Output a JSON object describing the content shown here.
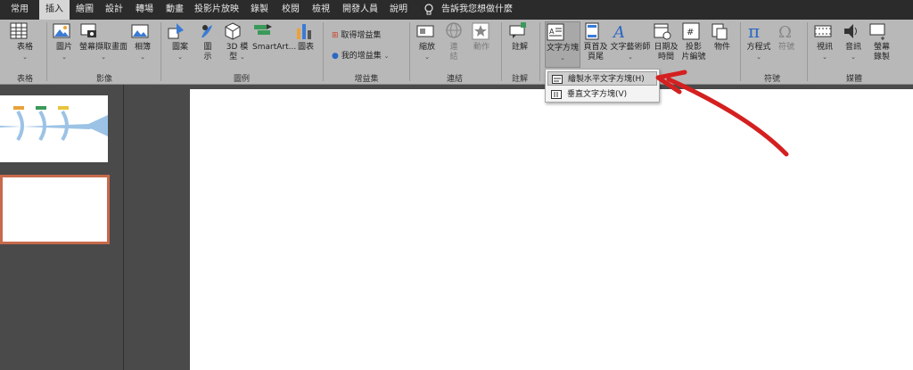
{
  "tabs": [
    "常用",
    "插入",
    "繪圖",
    "設計",
    "轉場",
    "動畫",
    "投影片放映",
    "錄製",
    "校閱",
    "檢視",
    "開發人員",
    "說明"
  ],
  "active_tab": "插入",
  "tell_me": "告訴我您想做什麼",
  "ribbon": {
    "table": {
      "label": "表格"
    },
    "images": {
      "pictures": "圖片",
      "screenshot": "螢幕擷取畫面",
      "album": "相簿"
    },
    "illustrations": {
      "shapes": "圖案",
      "icons_line1": "圖",
      "icons_line2": "示",
      "models_line1": "3D 模",
      "models_line2": "型",
      "smartart": "SmartArt...",
      "chart": "圖表"
    },
    "addins": {
      "get": "取得增益集",
      "my": "我的增益集"
    },
    "links": {
      "zoom": "縮放",
      "link_line1": "連",
      "link_line2": "結",
      "action": "動作"
    },
    "comments": {
      "comment": "註解"
    },
    "text": {
      "textbox": "文字方塊",
      "header_line1": "頁首及",
      "header_line2": "頁尾",
      "wordart": "文字藝術師",
      "datetime_line1": "日期及",
      "datetime_line2": "時間",
      "slidenum_line1": "投影",
      "slidenum_line2": "片編號",
      "object": "物件"
    },
    "symbols": {
      "equation": "方程式",
      "symbol": "符號"
    },
    "media": {
      "video": "視訊",
      "audio": "音訊",
      "record_line1": "螢幕",
      "record_line2": "錄製"
    },
    "groups": {
      "tables": "表格",
      "images": "影像",
      "illustrations": "圖例",
      "addins": "增益集",
      "links": "連結",
      "comments": "註解",
      "symbols": "符號",
      "media": "媒體"
    }
  },
  "textbox_menu": {
    "items": [
      "繪製水平文字方塊(H)",
      "垂直文字方塊(V)"
    ]
  },
  "colors": {
    "accent_tab": "#d6d6d6",
    "annotation_arrow": "#d42020",
    "selected_border": "#c76a4c"
  }
}
